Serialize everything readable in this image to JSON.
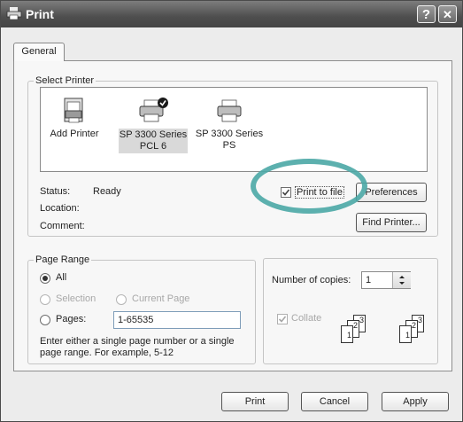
{
  "window": {
    "title": "Print",
    "help_btn": "?",
    "close_btn": "✕"
  },
  "tabs": [
    {
      "label": "General"
    }
  ],
  "select_printer": {
    "legend": "Select Printer",
    "printers": [
      {
        "label_line1": "Add Printer",
        "label_line2": ""
      },
      {
        "label_line1": "SP 3300 Series",
        "label_line2": "PCL 6",
        "selected": true,
        "default": true
      },
      {
        "label_line1": "SP 3300 Series",
        "label_line2": "PS"
      }
    ],
    "status_label": "Status:",
    "status_value": "Ready",
    "location_label": "Location:",
    "comment_label": "Comment:",
    "print_to_file": {
      "label": "Print to file",
      "checked": true
    },
    "preferences_btn": "Preferences",
    "find_printer_btn": "Find Printer..."
  },
  "page_range": {
    "legend": "Page Range",
    "all": "All",
    "selection": "Selection",
    "current_page": "Current Page",
    "pages": "Pages:",
    "pages_value": "1-65535",
    "hint_line1": "Enter either a single page number or a single",
    "hint_line2": "page range.  For example, 5-12"
  },
  "copies": {
    "label": "Number of copies:",
    "value": "1",
    "collate": "Collate",
    "collate_checked": true,
    "stack1": [
      "1",
      "2",
      "3"
    ],
    "stack2": [
      "1",
      "2",
      "3"
    ]
  },
  "buttons": {
    "print": "Print",
    "cancel": "Cancel",
    "apply": "Apply"
  },
  "colors": {
    "highlight_ring": "#4aa7a5"
  }
}
